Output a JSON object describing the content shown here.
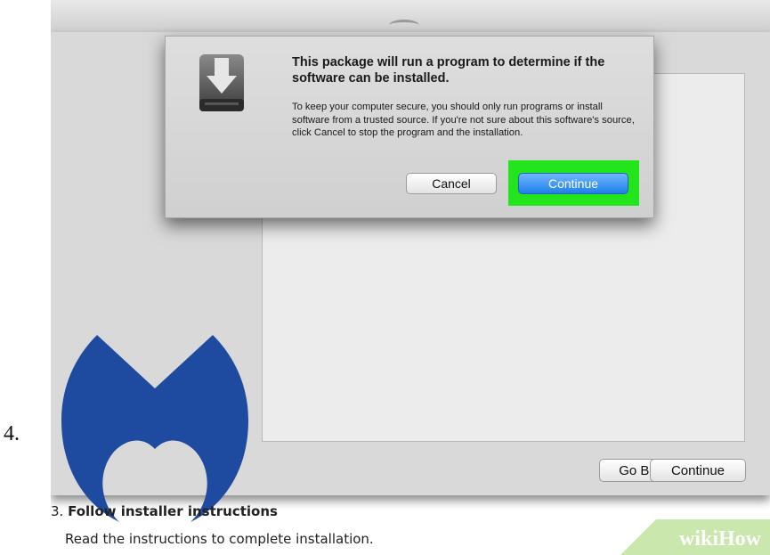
{
  "list_marker": "4.",
  "dialog": {
    "heading": "This package will run a program to determine if the software can be installed.",
    "body": "To keep your computer secure, you should only run programs or install software from a trusted source. If you're not sure about this software's source, click Cancel to stop the program and the installation.",
    "cancel_label": "Cancel",
    "continue_label": "Continue"
  },
  "installer": {
    "go_back_label": "Go Back",
    "continue_label": "Continue"
  },
  "step": {
    "number": "3.",
    "title": "Follow installer instructions",
    "description": "Read the instructions to complete installation."
  },
  "watermark": "wikiHow",
  "icons": [
    "package-download-icon",
    "malwarebytes-logo"
  ],
  "colors": {
    "highlight": "#22e51b",
    "continue_button": "#2a86ec",
    "logo_blue": "#1e4aa0",
    "watermark_green": "#7fae3f"
  }
}
